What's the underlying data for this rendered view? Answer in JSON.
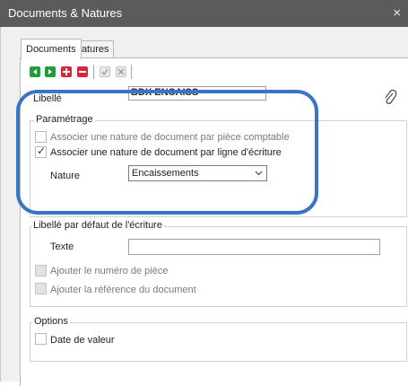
{
  "window": {
    "title": "Documents & Natures",
    "close_glyph": "×"
  },
  "tabs": [
    {
      "label": "Documents"
    },
    {
      "label": "Natures"
    }
  ],
  "form": {
    "libelle": {
      "label": "Libellé",
      "value": "BDX ENCAISS"
    }
  },
  "parametrage": {
    "title": "Paramétrage",
    "option1": {
      "label": "Associer une nature de document par pièce comptable",
      "checked": false
    },
    "option2": {
      "label": "Associer une nature de document par ligne d'écriture",
      "checked": true
    },
    "nature": {
      "label": "Nature",
      "value": "Encaissements"
    }
  },
  "libelle_defaut": {
    "title": "Libellé par défaut de l'écriture",
    "texte_label": "Texte",
    "texte_value": "",
    "cb_numero": {
      "label": "Ajouter le numéro de pièce"
    },
    "cb_reference": {
      "label": "Ajouter la référence du document"
    }
  },
  "options": {
    "title": "Options",
    "cb_date": {
      "label": "Date de valeur"
    }
  },
  "colors": {
    "titlebar": "#5b5b5b",
    "highlight": "#3a75c4",
    "green": "#1f9d3a",
    "red": "#d7263d"
  }
}
